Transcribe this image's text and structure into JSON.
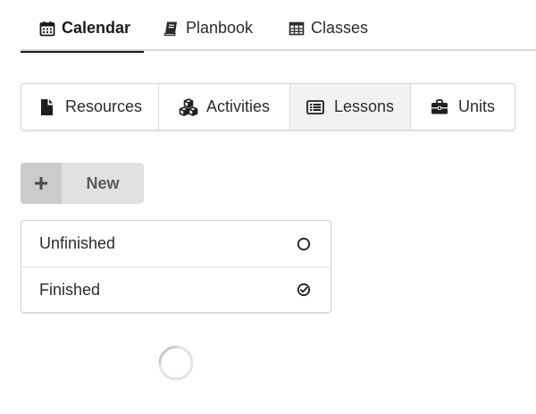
{
  "top_tabs": [
    {
      "label": "Calendar",
      "icon": "calendar-icon",
      "active": true
    },
    {
      "label": "Planbook",
      "icon": "book-icon",
      "active": false
    },
    {
      "label": "Classes",
      "icon": "table-icon",
      "active": false
    }
  ],
  "sections": [
    {
      "label": "Resources",
      "icon": "file-icon",
      "active": false
    },
    {
      "label": "Activities",
      "icon": "cubes-icon",
      "active": false
    },
    {
      "label": "Lessons",
      "icon": "list-alt-icon",
      "active": true
    },
    {
      "label": "Units",
      "icon": "briefcase-icon",
      "active": false
    }
  ],
  "new_button": {
    "label": "New",
    "icon": "plus-icon"
  },
  "filters": [
    {
      "label": "Unfinished",
      "icon": "circle-outline-icon"
    },
    {
      "label": "Finished",
      "icon": "check-circle-icon"
    }
  ],
  "loader": {
    "icon": "loading-spinner-icon"
  },
  "colors": {
    "accent": "#1b1b1b",
    "active_segment_bg": "#f2f2f2",
    "button_bg": "#e0e1e2",
    "button_icon_bg": "#cacbcd",
    "border": "#d4d4d5"
  }
}
